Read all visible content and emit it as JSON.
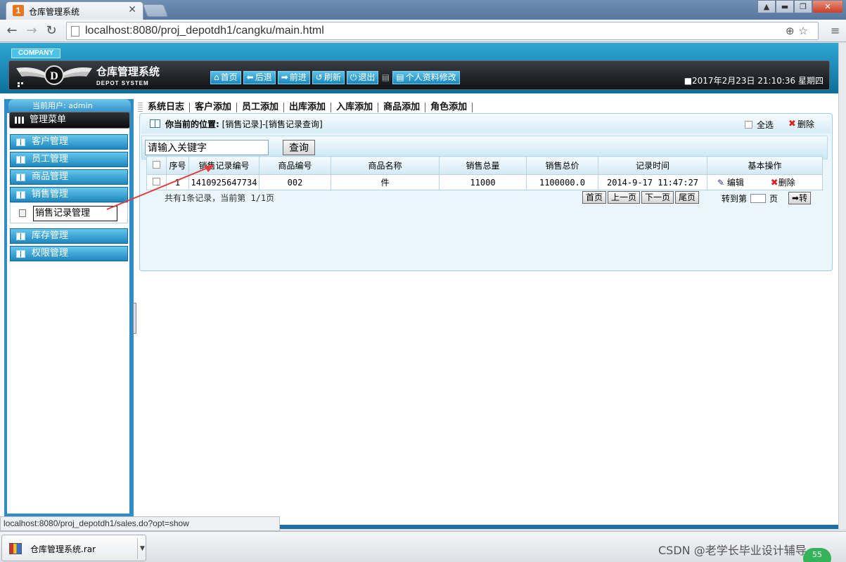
{
  "browser": {
    "tab_title": "仓库管理系统",
    "favicon_text": "1",
    "tab_close": "✕",
    "url": "localhost:8080/proj_depotdh1/cangku/main.html",
    "window_buttons": [
      "▲",
      "▬",
      "❐",
      "✕"
    ]
  },
  "header": {
    "company_badge": "COMPANY",
    "logo_letter": "D",
    "app_title": "仓库管理系统",
    "app_subtitle": "DEPOT  SYSTEM",
    "nav": [
      {
        "icon": "home-icon",
        "glyph": "⌂",
        "label": "首页"
      },
      {
        "icon": "back-icon",
        "glyph": "⬅",
        "label": "后退"
      },
      {
        "icon": "forward-icon",
        "glyph": "➡",
        "label": "前进"
      },
      {
        "icon": "refresh-icon",
        "glyph": "↺",
        "label": "刷新"
      },
      {
        "icon": "power-icon",
        "glyph": "⏻",
        "label": "退出"
      }
    ],
    "profile_label": "个人资料修改",
    "datetime": "■2017年2月23日 21:10:36 星期四"
  },
  "sidebar": {
    "user_label": "当前用户: admin",
    "menu_title": "管理菜单",
    "items": [
      {
        "label": "客户管理"
      },
      {
        "label": "员工管理"
      },
      {
        "label": "商品管理"
      },
      {
        "label": "销售管理"
      }
    ],
    "sub_item": "销售记录管理",
    "items_after": [
      {
        "label": "库存管理"
      },
      {
        "label": "权限管理"
      }
    ]
  },
  "quick_links": [
    "系统日志",
    "客户添加",
    "员工添加",
    "出库添加",
    "入库添加",
    "商品添加",
    "角色添加"
  ],
  "panel": {
    "crumb_label": "你当前的位置:",
    "crumb_path": "[销售记录]-[销售记录查询]",
    "select_all": "全选",
    "delete": "删除",
    "search_placeholder": "请输入关键字",
    "search_button": "查询"
  },
  "table": {
    "columns": [
      "序号",
      "销售记录编号",
      "商品编号",
      "商品名称",
      "销售总量",
      "销售总价",
      "记录时间",
      "基本操作"
    ],
    "rows": [
      {
        "no": "1",
        "record_id": "1410925647734",
        "product_id": "002",
        "product_name": "件",
        "total_qty": "11000",
        "total_price": "1100000.0",
        "time": "2014-9-17 11:47:27",
        "edit": "编辑",
        "delete": "删除"
      }
    ]
  },
  "pager": {
    "info": "共有1条记录，当前第 1/1页",
    "first": "首页",
    "prev": "上一页",
    "next": "下一页",
    "last": "尾页",
    "goto_label": "转到第",
    "page_unit": "页",
    "go": "➡转"
  },
  "status_url": "localhost:8080/proj_depotdh1/sales.do?opt=show",
  "download": {
    "file": "仓库管理系统.rar"
  },
  "watermark": "CSDN @老学长毕业设计辅导",
  "badge": "55",
  "colors": {
    "accent": "#1d87be",
    "header_dark": "#111316",
    "annotation_arrow": "#e23b3b"
  }
}
